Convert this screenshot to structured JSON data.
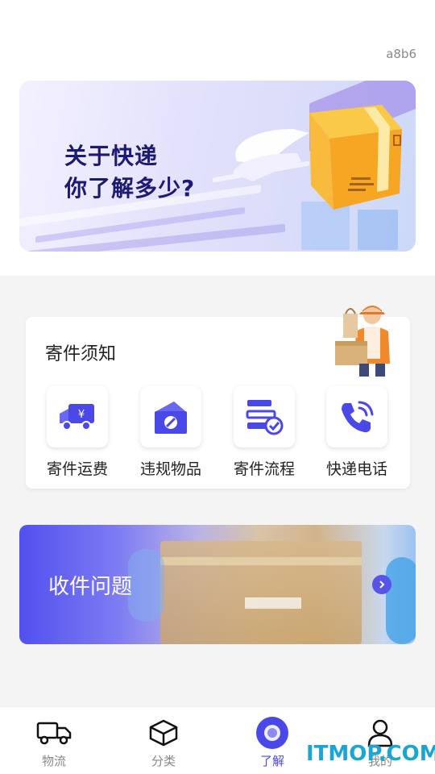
{
  "header": {
    "corner_label": "a8b6"
  },
  "hero": {
    "line1": "关于快递",
    "line2": "你了解多少?"
  },
  "notice": {
    "title": "寄件须知",
    "items": [
      {
        "label": "寄件运费",
        "icon": "truck-yen-icon"
      },
      {
        "label": "违规物品",
        "icon": "forbidden-box-icon"
      },
      {
        "label": "寄件流程",
        "icon": "process-checklist-icon"
      },
      {
        "label": "快递电话",
        "icon": "phone-ring-icon"
      }
    ]
  },
  "receive": {
    "title": "收件问题"
  },
  "tabs": [
    {
      "label": "物流",
      "icon": "truck-icon",
      "active": false
    },
    {
      "label": "分类",
      "icon": "box-layers-icon",
      "active": false
    },
    {
      "label": "了解",
      "icon": "explore-icon",
      "active": true
    },
    {
      "label": "我的",
      "icon": "user-icon",
      "active": false
    }
  ],
  "watermark": "ITMOP.COM",
  "colors": {
    "accent": "#4b48e8",
    "hero_title": "#1d1a73",
    "background_gray": "#f4f4f4"
  }
}
